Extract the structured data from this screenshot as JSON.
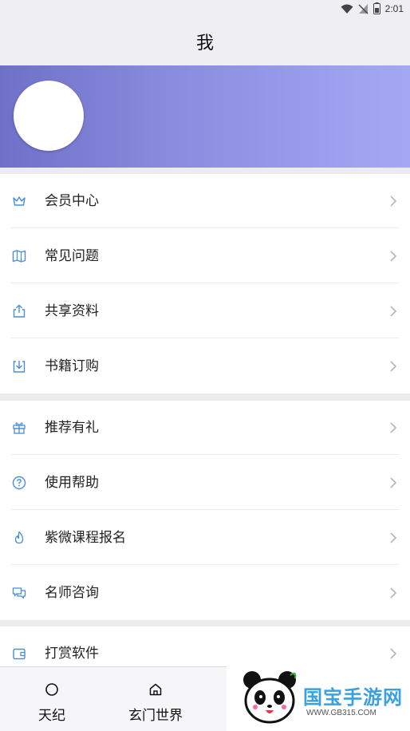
{
  "status_bar": {
    "time": "2:01"
  },
  "header": {
    "title": "我"
  },
  "menu": {
    "section1": [
      {
        "label": "会员中心",
        "icon": "crown-icon"
      },
      {
        "label": "常见问题",
        "icon": "map-icon"
      },
      {
        "label": "共享资料",
        "icon": "share-icon"
      },
      {
        "label": "书籍订购",
        "icon": "download-icon"
      }
    ],
    "section2": [
      {
        "label": "推荐有礼",
        "icon": "gift-icon"
      },
      {
        "label": "使用帮助",
        "icon": "question-icon"
      },
      {
        "label": "紫微课程报名",
        "icon": "flame-icon"
      },
      {
        "label": "名师咨询",
        "icon": "chat-icon"
      }
    ],
    "section3": [
      {
        "label": "打赏软件",
        "icon": "wallet-icon"
      }
    ]
  },
  "bottom_nav": {
    "tabs": [
      {
        "label": "天纪",
        "icon": "circle-icon"
      },
      {
        "label": "玄门世界",
        "icon": "home-icon"
      }
    ]
  },
  "watermark": {
    "text": "国宝手游网",
    "url": "WWW.GB315.COM"
  },
  "colors": {
    "accent": "#4a8fd6",
    "header_bg": "#efeff3",
    "gradient_start": "#6f70c8",
    "gradient_end": "#a4a8f4"
  }
}
